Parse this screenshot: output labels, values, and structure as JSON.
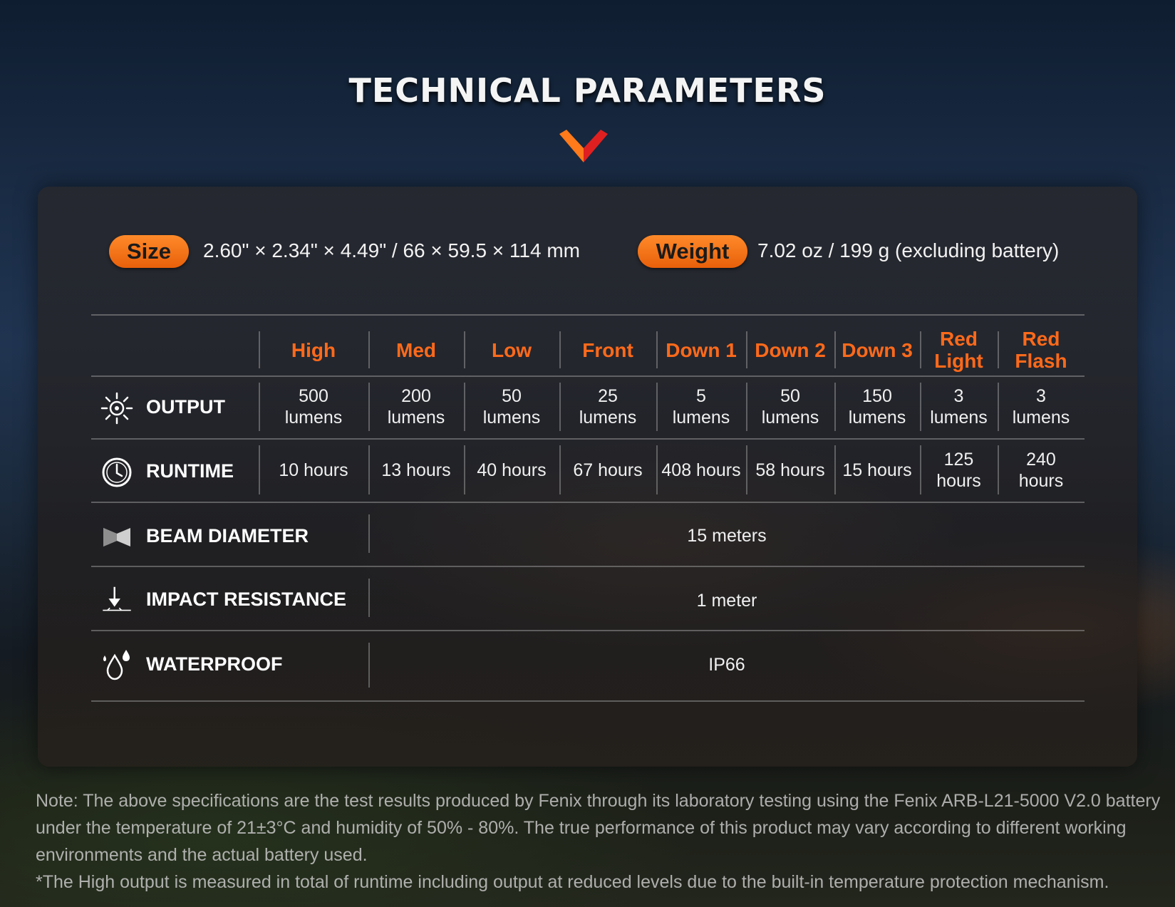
{
  "title": "TECHNICAL PARAMETERS",
  "colors": {
    "accent": "#ff6a1a",
    "pill": "#f27414",
    "chevron_red": "#e02020",
    "chevron_orange": "#ff7a1a"
  },
  "size": {
    "label": "Size",
    "value": "2.60\" × 2.34\" × 4.49\" / 66 × 59.5 × 114 mm"
  },
  "weight": {
    "label": "Weight",
    "value": "7.02 oz / 199 g (excluding battery)"
  },
  "table": {
    "columns": [
      [
        "High"
      ],
      [
        "Med"
      ],
      [
        "Low"
      ],
      [
        "Front"
      ],
      [
        "Down 1"
      ],
      [
        "Down 2"
      ],
      [
        "Down 3"
      ],
      [
        "Red",
        "Light"
      ],
      [
        "Red",
        "Flash"
      ]
    ],
    "output": {
      "label": "OUTPUT",
      "icon": "sun-icon",
      "values": [
        [
          "500",
          "lumens"
        ],
        [
          "200",
          "lumens"
        ],
        [
          "50",
          "lumens"
        ],
        [
          "25",
          "lumens"
        ],
        [
          "5",
          "lumens"
        ],
        [
          "50",
          "lumens"
        ],
        [
          "150",
          "lumens"
        ],
        [
          "3",
          "lumens"
        ],
        [
          "3",
          "lumens"
        ]
      ]
    },
    "runtime": {
      "label": "RUNTIME",
      "icon": "clock-icon",
      "values": [
        [
          "10 hours"
        ],
        [
          "13 hours"
        ],
        [
          "40 hours"
        ],
        [
          "67 hours"
        ],
        [
          "408 hours"
        ],
        [
          "58 hours"
        ],
        [
          "15 hours"
        ],
        [
          "125",
          "hours"
        ],
        [
          "240",
          "hours"
        ]
      ]
    },
    "beam": {
      "label": "BEAM DIAMETER",
      "icon": "beam-icon",
      "value": "15 meters"
    },
    "impact": {
      "label": "IMPACT RESISTANCE",
      "icon": "impact-arrow-icon",
      "value": "1 meter"
    },
    "waterproof": {
      "label": "WATERPROOF",
      "icon": "water-drop-icon",
      "value": "IP66"
    }
  },
  "note": {
    "line1": "Note: The above specifications are the test results produced by Fenix through its laboratory testing using the Fenix ARB-L21-5000 V2.0 battery under the temperature of 21±3°C and humidity of 50% - 80%. The true performance of this product may vary according to different working environments and the actual battery used.",
    "line2": "*The High output is measured in total of runtime including output at reduced levels due to the built-in temperature protection mechanism."
  }
}
